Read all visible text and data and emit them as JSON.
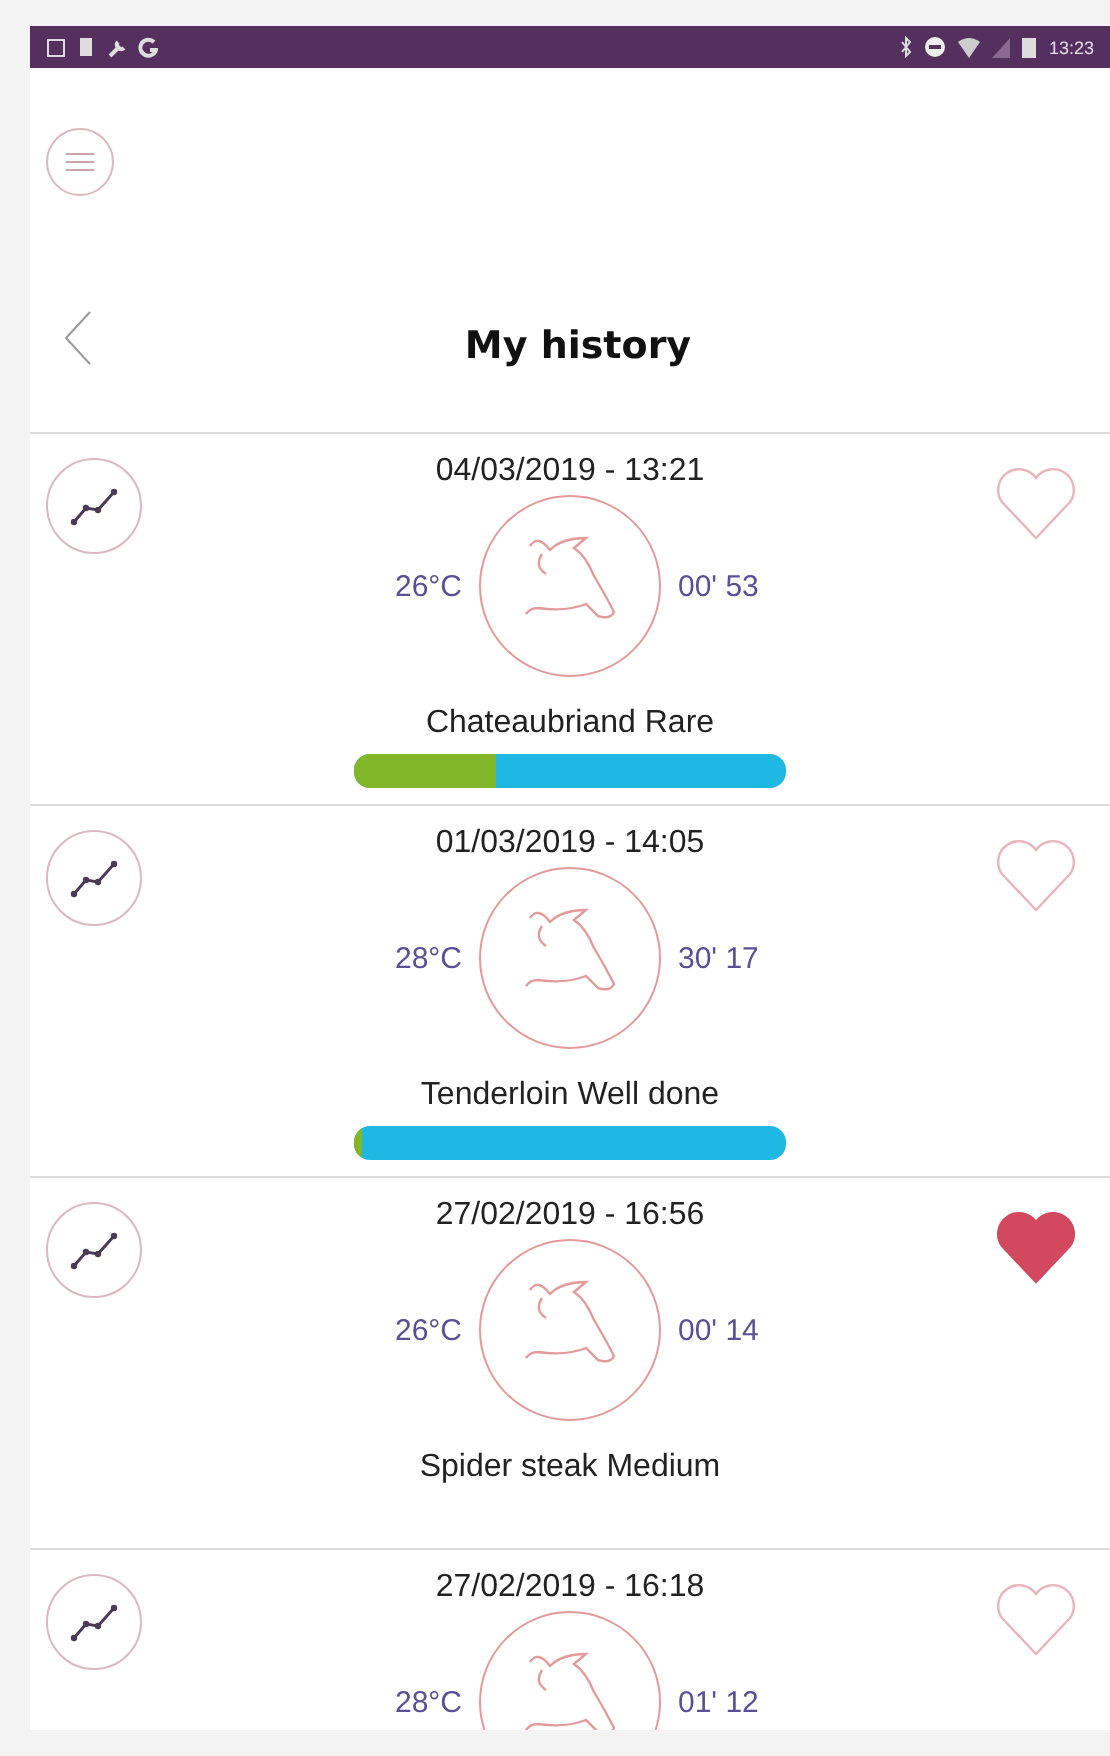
{
  "status_bar": {
    "time": "13:23"
  },
  "header": {
    "title": "My history"
  },
  "history": [
    {
      "date": "04/03/2019 - 13:21",
      "temperature": "26°C",
      "duration": "00' 53",
      "name": "Chateaubriand Rare",
      "favorite": false,
      "level": 0.33
    },
    {
      "date": "01/03/2019 - 14:05",
      "temperature": "28°C",
      "duration": "30' 17",
      "name": "Tenderloin Well done",
      "favorite": false,
      "level": 0.02
    },
    {
      "date": "27/02/2019 - 16:56",
      "temperature": "26°C",
      "duration": "00' 14",
      "name": "Spider steak Medium",
      "favorite": true
    },
    {
      "date": "27/02/2019 - 16:18",
      "temperature": "28°C",
      "duration": "01' 12",
      "favorite": false
    }
  ]
}
